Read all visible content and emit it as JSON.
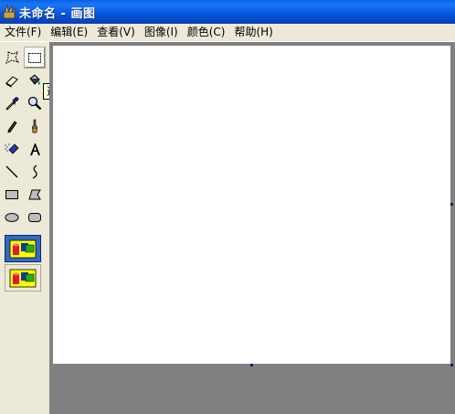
{
  "window": {
    "title": "未命名 - 画图",
    "app_icon": "paint-icon"
  },
  "menubar": {
    "items": [
      {
        "label": "文件(F)"
      },
      {
        "label": "编辑(E)"
      },
      {
        "label": "查看(V)"
      },
      {
        "label": "图像(I)"
      },
      {
        "label": "颜色(C)"
      },
      {
        "label": "帮助(H)"
      }
    ]
  },
  "toolbox": {
    "tools": [
      {
        "name": "free-form-select",
        "icon": "freeform-select-icon"
      },
      {
        "name": "rect-select",
        "icon": "rect-select-icon",
        "selected": true
      },
      {
        "name": "eraser",
        "icon": "eraser-icon"
      },
      {
        "name": "fill",
        "icon": "fill-bucket-icon"
      },
      {
        "name": "pick-color",
        "icon": "eyedropper-icon"
      },
      {
        "name": "magnifier",
        "icon": "magnifier-icon"
      },
      {
        "name": "pencil",
        "icon": "pencil-icon"
      },
      {
        "name": "brush",
        "icon": "brush-icon"
      },
      {
        "name": "airbrush",
        "icon": "airbrush-icon"
      },
      {
        "name": "text",
        "icon": "text-icon"
      },
      {
        "name": "line",
        "icon": "line-icon"
      },
      {
        "name": "curve",
        "icon": "curve-icon"
      },
      {
        "name": "rectangle",
        "icon": "rectangle-icon"
      },
      {
        "name": "polygon",
        "icon": "polygon-icon"
      },
      {
        "name": "ellipse",
        "icon": "ellipse-icon"
      },
      {
        "name": "rounded-rectangle",
        "icon": "rounded-rect-icon"
      }
    ],
    "tooltip": "选定",
    "options": [
      {
        "name": "transparent-off",
        "icon": "opaque-selection-icon",
        "active": true
      },
      {
        "name": "transparent-on",
        "icon": "transparent-selection-icon",
        "active": false
      }
    ]
  },
  "colors": {
    "title_bar": "#0a5ee5",
    "workspace": "#808080",
    "canvas": "#ffffff",
    "handle": "#0a246a"
  }
}
